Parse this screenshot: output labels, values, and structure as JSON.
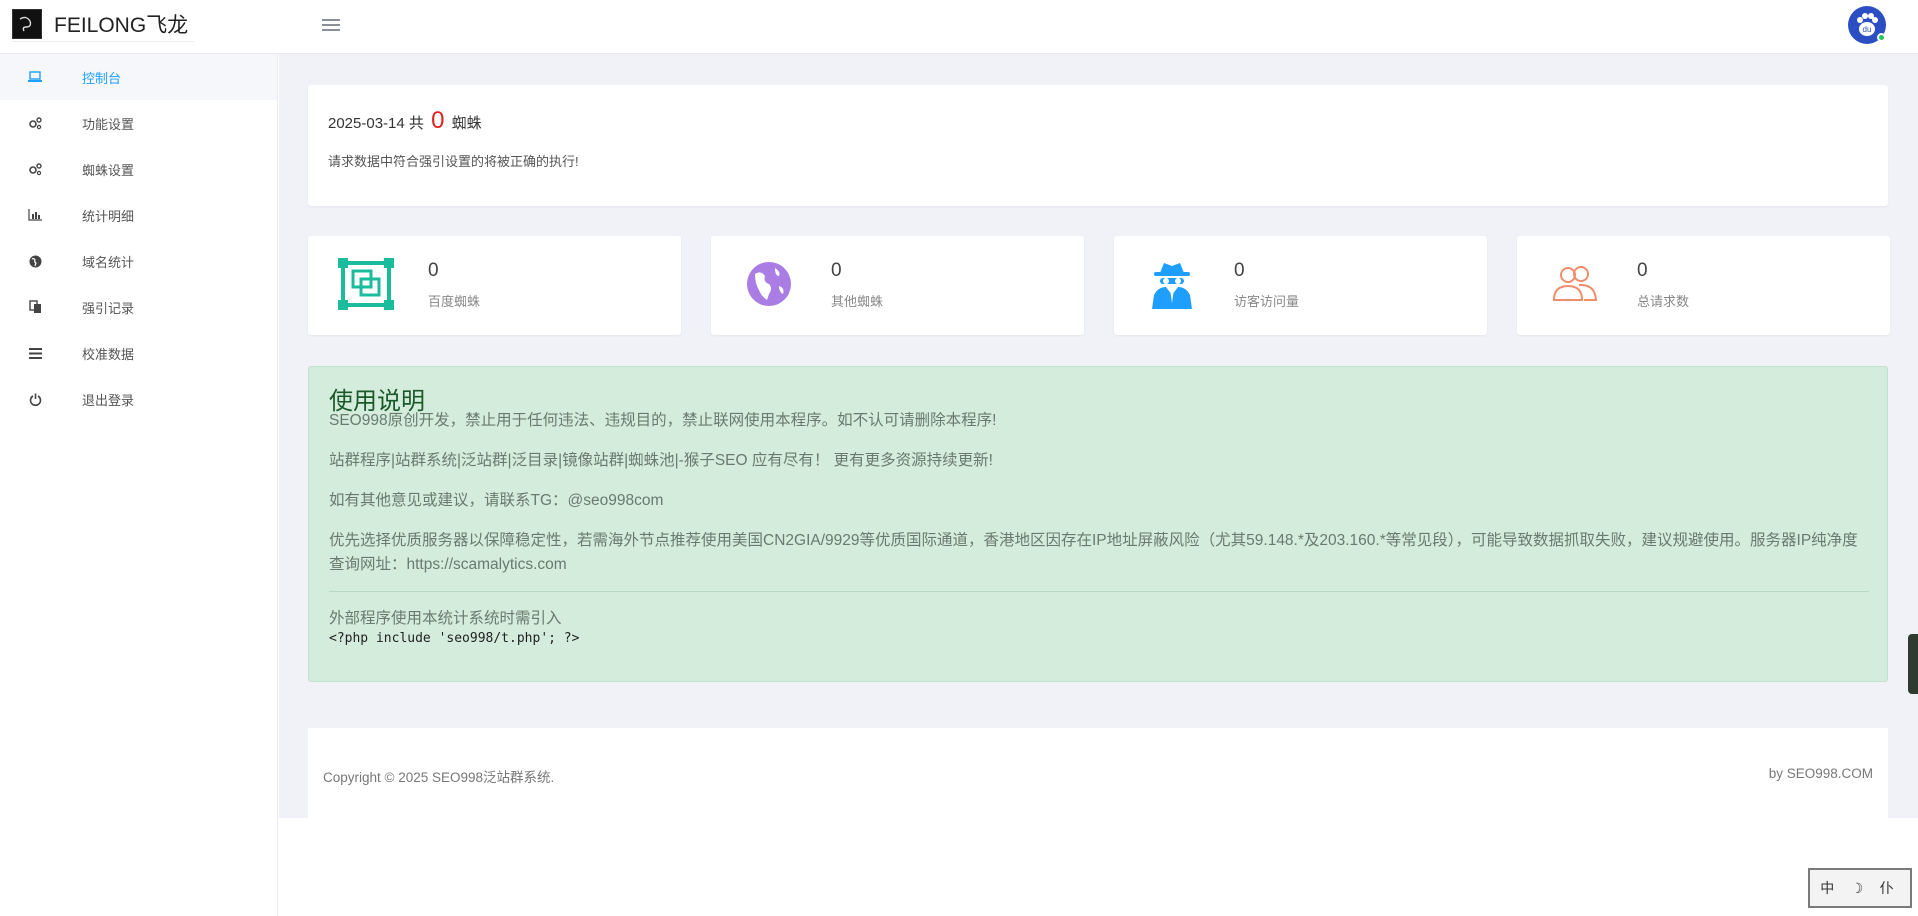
{
  "header": {
    "brand_text": "FEILONG飞龙"
  },
  "sidebar": {
    "items": [
      {
        "label": "控制台",
        "icon": "laptop-icon",
        "active": true
      },
      {
        "label": "功能设置",
        "icon": "gears-icon"
      },
      {
        "label": "蜘蛛设置",
        "icon": "gears-icon"
      },
      {
        "label": "统计明细",
        "icon": "bar-chart-icon"
      },
      {
        "label": "域名统计",
        "icon": "globe-icon"
      },
      {
        "label": "强引记录",
        "icon": "copy-icon"
      },
      {
        "label": "校准数据",
        "icon": "list-icon"
      },
      {
        "label": "退出登录",
        "icon": "power-icon"
      }
    ]
  },
  "today": {
    "date": "2025-03-14",
    "prefix": "共",
    "count": "0",
    "suffix": "蜘蛛",
    "note": "请求数据中符合强引设置的将被正确的执行!"
  },
  "stats": [
    {
      "value": "0",
      "label": "百度蜘蛛",
      "icon": "frame-icon",
      "color": "#1abc9c"
    },
    {
      "value": "0",
      "label": "其他蜘蛛",
      "icon": "globe-icon",
      "color": "#a97de3"
    },
    {
      "value": "0",
      "label": "访客访问量",
      "icon": "spy-icon",
      "color": "#1e9fff"
    },
    {
      "value": "0",
      "label": "总请求数",
      "icon": "users-icon",
      "color": "#f08c6c"
    }
  ],
  "notice": {
    "title": "使用说明",
    "p1": "SEO998原创开发，禁止用于任何违法、违规目的，禁止联网使用本程序。如不认可请删除本程序!",
    "p2": "站群程序|站群系统|泛站群|泛目录|镜像站群|蜘蛛池|-猴子SEO 应有尽有！ 更有更多资源持续更新!",
    "p3": "如有其他意见或建议，请联系TG：@seo998com",
    "p4": "优先选择优质服务器以保障稳定性，若需海外节点推荐使用美国CN2GIA/9929等优质国际通道，香港地区因存在IP地址屏蔽风险（尤其59.148.*及203.160.*等常见段），可能导致数据抓取失败，建议规避使用。服务器IP纯净度查询网址：https://scamalytics.com",
    "p5": "外部程序使用本统计系统时需引入",
    "code": "<?php include 'seo998/t.php'; ?>"
  },
  "footer": {
    "left": "Copyright © 2025 SEO998泛站群系统.",
    "right": "by SEO998.COM"
  },
  "stamp": {
    "text": "中 ☽ 仆"
  }
}
